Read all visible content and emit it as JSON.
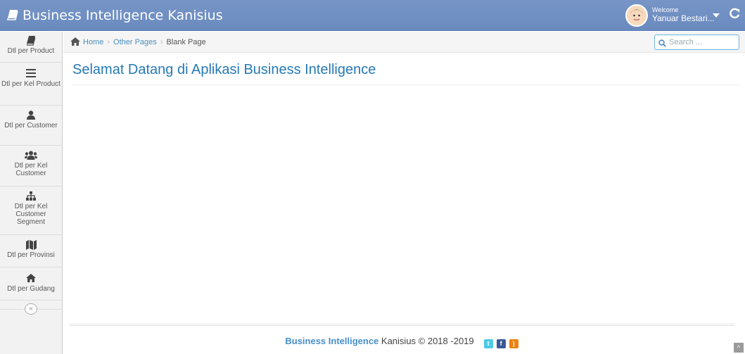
{
  "navbar": {
    "brand": "Business Intelligence Kanisius",
    "welcome": "Welcome",
    "user_name": "Yanuar Bestari...",
    "brand_color": "#6f8fc2"
  },
  "sidebar": {
    "items": [
      {
        "label": "Dtl per Product",
        "icon": "book-icon"
      },
      {
        "label": "Dtl per Kel Product",
        "icon": "list-icon"
      },
      {
        "label": "Dtl per Customer",
        "icon": "user-icon"
      },
      {
        "label": "Dtl per Kel Customer",
        "icon": "users-icon"
      },
      {
        "label": "Dtl per Kel Customer Segment",
        "icon": "sitemap-icon"
      },
      {
        "label": "Dtl per Provinsi",
        "icon": "map-icon"
      },
      {
        "label": "Dtl per Gudang",
        "icon": "home-icon"
      }
    ],
    "collapse_glyph": "«"
  },
  "breadcrumbs": {
    "home": "Home",
    "other": "Other Pages",
    "active": "Blank Page"
  },
  "search": {
    "placeholder": "Search ..."
  },
  "page": {
    "title": "Selamat Datang di Aplikasi Business Intelligence"
  },
  "footer": {
    "brand": "Business Intelligence",
    "rest": " Kanisius © 2018 -2019"
  }
}
